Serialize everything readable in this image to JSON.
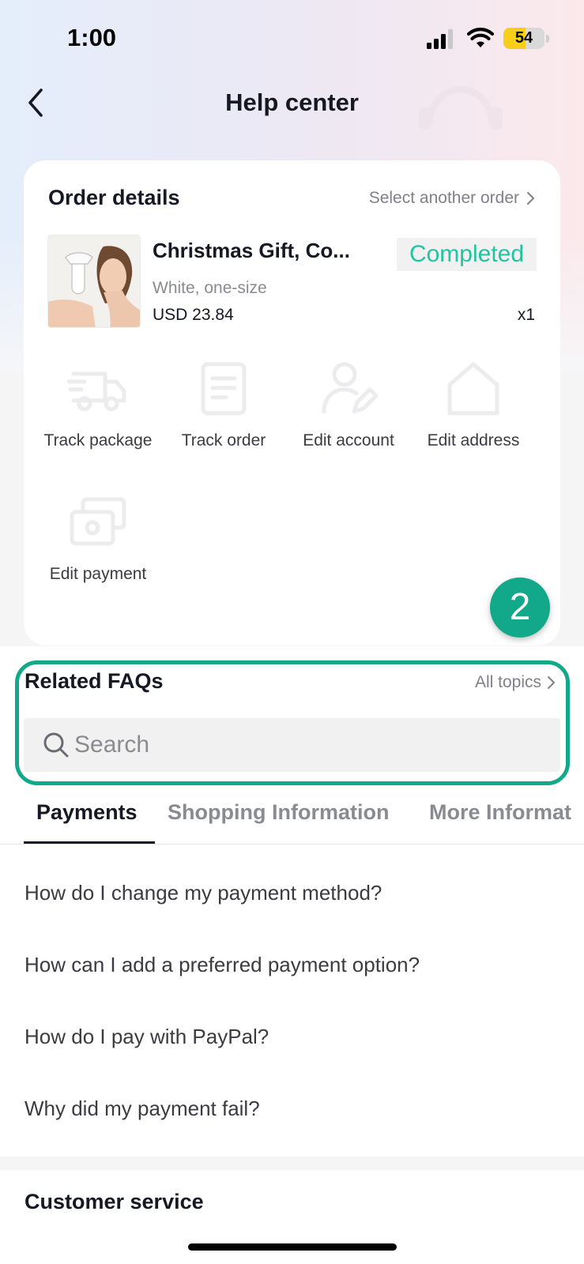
{
  "status_bar": {
    "time": "1:00",
    "battery": "54",
    "battery_level": 0.54
  },
  "header": {
    "title": "Help center"
  },
  "order": {
    "title": "Order details",
    "select_link": "Select another order",
    "product_name": "Christmas Gift, Co...",
    "variant": "White, one-size",
    "price": "USD 23.84",
    "status": "Completed",
    "quantity": "x1",
    "actions": [
      {
        "label": "Track package",
        "icon": "truck-icon"
      },
      {
        "label": "Track order",
        "icon": "document-icon"
      },
      {
        "label": "Edit account",
        "icon": "user-edit-icon"
      },
      {
        "label": "Edit address",
        "icon": "home-icon"
      },
      {
        "label": "Edit payment",
        "icon": "payment-icon"
      }
    ]
  },
  "step_marker": "2",
  "faq": {
    "title": "Related FAQs",
    "all_topics": "All topics",
    "search_placeholder": "Search",
    "tabs": [
      "Payments",
      "Shopping Information",
      "More Informat"
    ],
    "active_tab": 0,
    "questions": [
      "How do I change my payment method?",
      "How can I add a preferred payment option?",
      "How do I pay with PayPal?",
      "Why did my payment fail?"
    ]
  },
  "customer_service": {
    "title": "Customer service"
  },
  "colors": {
    "accent": "#12a98a",
    "status_green": "#20c5a0",
    "text_primary": "#161823",
    "text_secondary": "#8a8b91"
  }
}
